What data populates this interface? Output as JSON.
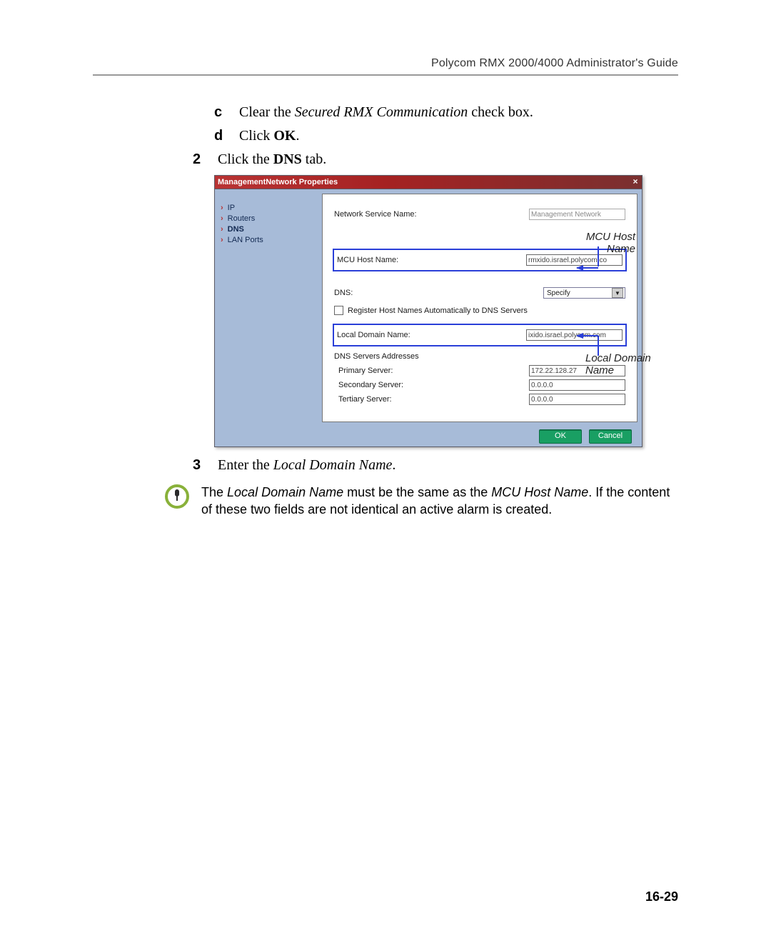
{
  "header": {
    "title": "Polycom RMX 2000/4000 Administrator's Guide"
  },
  "steps": {
    "c_prefix": "c",
    "c_text_1": "Clear the ",
    "c_text_italic": "Secured RMX Communication",
    "c_text_2": " check box.",
    "d_prefix": "d",
    "d_text_1": "Click ",
    "d_text_bold": "OK",
    "d_text_2": ".",
    "n2_prefix": "2",
    "n2_text_1": "Click the ",
    "n2_text_bold": "DNS",
    "n2_text_2": " tab.",
    "n3_prefix": "3",
    "n3_text_1": "Enter the ",
    "n3_text_italic": "Local Domain Name",
    "n3_text_2": "."
  },
  "dialog": {
    "title": "ManagementNetwork Properties",
    "close": "×",
    "nav": {
      "ip": "IP",
      "routers": "Routers",
      "dns": "DNS",
      "lan_ports": "LAN Ports"
    },
    "form": {
      "network_service_name_label": "Network Service Name:",
      "network_service_name_value": "Management Network",
      "mcu_host_name_label": "MCU Host Name:",
      "mcu_host_name_value": "rmxido.israel.polycom.co",
      "dns_label": "DNS:",
      "dns_value": "Specify",
      "register_label": "Register Host Names Automatically to DNS Servers",
      "local_domain_name_label": "Local Domain Name:",
      "local_domain_name_value": "ixido.israel.polycom.com",
      "dns_servers_addresses": "DNS Servers Addresses",
      "primary_server_label": "Primary Server:",
      "primary_server_value": "172.22.128.27",
      "secondary_server_label": "Secondary Server:",
      "secondary_server_value": "0.0.0.0",
      "tertiary_server_label": "Tertiary Server:",
      "tertiary_server_value": "0.0.0.0"
    },
    "buttons": {
      "ok": "OK",
      "cancel": "Cancel"
    }
  },
  "callouts": {
    "mcu_host_line1": "MCU Host",
    "mcu_host_line2": "Name",
    "local_domain_line1": "Local Domain",
    "local_domain_line2": "Name"
  },
  "note": {
    "text_1": "The ",
    "text_italic_1": "Local Domain Name",
    "text_2": " must be the same as the ",
    "text_italic_2": "MCU Host Name",
    "text_3": ". If the content of these two fields are not identical an active alarm is created."
  },
  "page_number": "16-29"
}
